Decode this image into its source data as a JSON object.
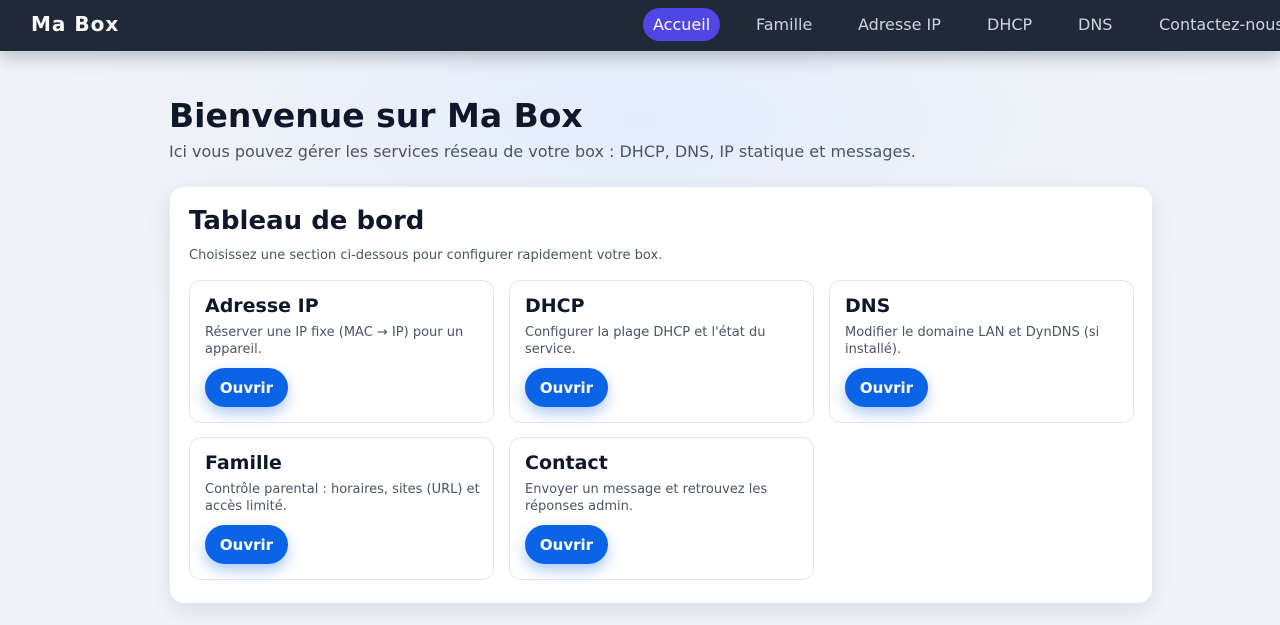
{
  "app": {
    "brand": "Ma Box"
  },
  "nav": {
    "items": [
      {
        "label": "Accueil",
        "active": true
      },
      {
        "label": "Famille"
      },
      {
        "label": "Adresse IP"
      },
      {
        "label": "DHCP"
      },
      {
        "label": "DNS"
      },
      {
        "label": "Contactez-nous"
      }
    ]
  },
  "page": {
    "title": "Bienvenue sur Ma Box",
    "subtitle": "Ici vous pouvez gérer les services réseau de votre box : DHCP, DNS, IP statique et messages."
  },
  "dashboard": {
    "title": "Tableau de bord",
    "subtitle": "Choisissez une section ci-dessous pour configurer rapidement votre box.",
    "cards": [
      {
        "title": "Adresse IP",
        "description": "Réserver une IP fixe (MAC → IP) pour un appareil.",
        "button": "Ouvrir"
      },
      {
        "title": "DHCP",
        "description": "Configurer la plage DHCP et l'état du service.",
        "button": "Ouvrir"
      },
      {
        "title": "DNS",
        "description": "Modifier le domaine LAN et DynDNS (si installé).",
        "button": "Ouvrir"
      },
      {
        "title": "Famille",
        "description": "Contrôle parental : horaires, sites (URL) et accès limité.",
        "button": "Ouvrir"
      },
      {
        "title": "Contact",
        "description": "Envoyer un message et retrouvez les réponses admin.",
        "button": "Ouvrir"
      }
    ]
  },
  "colors": {
    "topbar": "#1f2937",
    "nav_active": "#4f46e5",
    "button": "#0b63e5"
  }
}
